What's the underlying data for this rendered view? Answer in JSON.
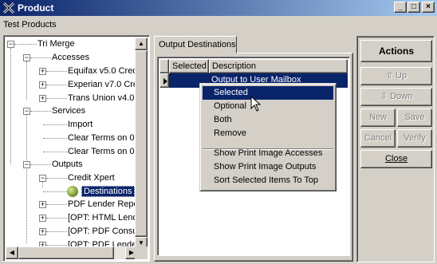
{
  "window": {
    "title": "Product"
  },
  "menubar": {
    "label": "Test Products"
  },
  "tree": {
    "root": "Tri Merge",
    "accesses": "Accesses",
    "access_items": [
      "Equifax v5.0 Credit Re",
      "Experian v7.0 Credit R",
      "Trans Union v4.0 Cre"
    ],
    "services": "Services",
    "service_items": [
      "Import",
      "Clear Terms on 0 Bala",
      "Clear Terms on 0 Bala"
    ],
    "outputs": "Outputs",
    "credit_xpert": "Credit Xpert",
    "destinations": "Destinations",
    "output_items": [
      "PDF Lender Report",
      "[OPT: HTML Lender I",
      "[OPT: PDF Consumer",
      "[OPT: PDF Lender Su"
    ]
  },
  "tab": {
    "label": "Output Destinations"
  },
  "grid": {
    "columns": [
      "Selected",
      "Description"
    ],
    "rows": [
      {
        "selected": "",
        "description": "Output to User Mailbox"
      }
    ]
  },
  "context_menu": {
    "items": [
      "Selected",
      "Optional",
      "Both",
      "Remove"
    ],
    "items2": [
      "Show Print Image Accesses",
      "Show Print Image Outputs",
      "Sort Selected Items To Top"
    ]
  },
  "actions": {
    "title": "Actions",
    "up": "Up",
    "down": "Down",
    "new": "New",
    "save": "Save",
    "cancel": "Cancel",
    "verify": "Verify",
    "close": "Close"
  }
}
